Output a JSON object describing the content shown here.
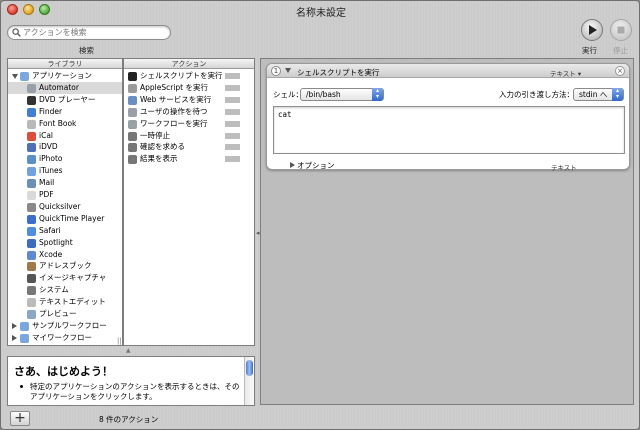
{
  "window": {
    "title": "名称未設定"
  },
  "toolbar": {
    "search_placeholder": "アクションを検索",
    "search_caption": "検索",
    "run_label": "実行",
    "stop_label": "停止"
  },
  "library": {
    "header": "ライブラリ",
    "items": [
      {
        "label": "アプリケーション",
        "icon": "applications-folder-icon",
        "expanded": true
      },
      {
        "label": "Automator",
        "icon": "automator-icon",
        "selected": true
      },
      {
        "label": "DVD プレーヤー",
        "icon": "dvd-player-icon"
      },
      {
        "label": "Finder",
        "icon": "finder-icon"
      },
      {
        "label": "Font Book",
        "icon": "font-book-icon"
      },
      {
        "label": "iCal",
        "icon": "ical-icon"
      },
      {
        "label": "iDVD",
        "icon": "idvd-icon"
      },
      {
        "label": "iPhoto",
        "icon": "iphoto-icon"
      },
      {
        "label": "iTunes",
        "icon": "itunes-icon"
      },
      {
        "label": "Mail",
        "icon": "mail-icon"
      },
      {
        "label": "PDF",
        "icon": "pdf-icon"
      },
      {
        "label": "Quicksilver",
        "icon": "quicksilver-icon"
      },
      {
        "label": "QuickTime Player",
        "icon": "quicktime-icon"
      },
      {
        "label": "Safari",
        "icon": "safari-icon"
      },
      {
        "label": "Spotlight",
        "icon": "spotlight-icon"
      },
      {
        "label": "Xcode",
        "icon": "xcode-icon"
      },
      {
        "label": "アドレスブック",
        "icon": "address-book-icon"
      },
      {
        "label": "イメージキャプチャ",
        "icon": "image-capture-icon"
      },
      {
        "label": "システム",
        "icon": "system-icon"
      },
      {
        "label": "テキストエディット",
        "icon": "textedit-icon"
      },
      {
        "label": "プレビュー",
        "icon": "preview-icon"
      },
      {
        "label": "サンプルワークフロー",
        "icon": "folder-icon",
        "collapsed": true
      },
      {
        "label": "マイワークフロー",
        "icon": "folder-icon",
        "collapsed": true
      }
    ]
  },
  "actions": {
    "header": "アクション",
    "items": [
      {
        "label": "シェルスクリプトを実行",
        "icon": "terminal-icon"
      },
      {
        "label": "AppleScript を実行",
        "icon": "applescript-icon"
      },
      {
        "label": "Web サービスを実行",
        "icon": "web-service-icon"
      },
      {
        "label": "ユーザの操作を待つ",
        "icon": "automator-icon"
      },
      {
        "label": "ワークフローを実行",
        "icon": "automator-icon"
      },
      {
        "label": "一時停止",
        "icon": "tools-icon"
      },
      {
        "label": "確認を求める",
        "icon": "tools-icon"
      },
      {
        "label": "結果を表示",
        "icon": "tools-icon"
      }
    ],
    "count_label": "8 件のアクション"
  },
  "description": {
    "title": "さあ、はじめよう！",
    "text": "特定のアプリケーションのアクションを表示するときは、そのアプリケーションをクリックします。"
  },
  "workflow": {
    "action_number": "1",
    "action_title": "シェルスクリプトを実行",
    "input_type": "テキスト ▾",
    "shell_label": "シェル：",
    "shell_value": "/bin/bash",
    "pass_label": "入力の引き渡し方法：",
    "pass_value": "stdin へ",
    "script": "cat",
    "options_label": "オプション",
    "output_type": "テキスト"
  }
}
